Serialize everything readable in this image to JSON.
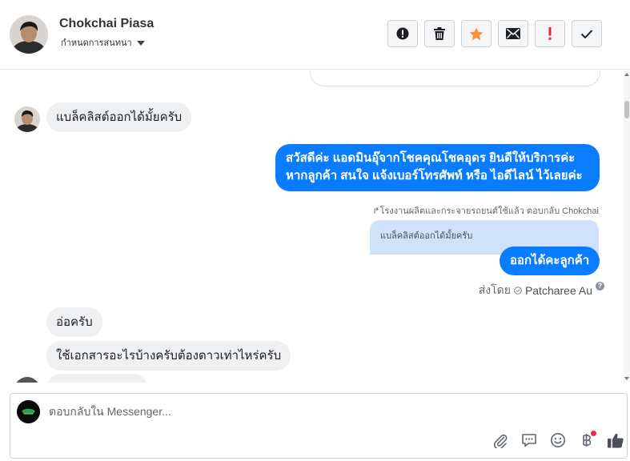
{
  "header": {
    "contact_name": "Chokchai Piasa",
    "stage_label": "กำหนดการสนทนา",
    "actions": [
      {
        "id": "spam",
        "icon": "alert-circle-icon"
      },
      {
        "id": "delete",
        "icon": "trash-icon"
      },
      {
        "id": "star",
        "icon": "star-icon",
        "color": "#f7923b"
      },
      {
        "id": "unread",
        "icon": "envelope-icon"
      },
      {
        "id": "important",
        "icon": "exclamation-icon",
        "color": "#e02c2c"
      },
      {
        "id": "done",
        "icon": "checkmark-icon"
      }
    ]
  },
  "conversation": {
    "messages": [
      {
        "from": "customer",
        "text": "แบล็คลิสต์ออกได้มั้ยครับ"
      },
      {
        "from": "page",
        "lines": [
          "สวัสดีค่ะ แอดมินอุ๊จากโชคคุณโชคอุดร ยินดีให้บริการค่ะ",
          "หากลูกค้า สนใจ แจ้งเบอร์โทรศัพท์ หรือ ไอดีไลน์  ไว้เลยค่ะ"
        ]
      },
      {
        "from": "page",
        "reply_meta": "โรงงานผลิตและกระจายรถยนต์ใช้แล้ว ตอบกลับ Chokchai",
        "quoted_text": "แบล็คลิสต์ออกได้มั้ยครับ",
        "text": "ออกได้คะลูกค้า"
      },
      {
        "from": "customer",
        "text": "อ่อครับ"
      },
      {
        "from": "customer",
        "text": "ใช้เอกสารอะไรบ้างครับต้องดาวเท่าไหร่ครับ"
      }
    ],
    "sent_by_label": "ส่งโดย",
    "sent_by_agent": "Patcharee Au",
    "info_icon": "?"
  },
  "composer": {
    "placeholder": "ตอบกลับใน Messenger...",
    "tools": [
      {
        "id": "attach",
        "icon": "paperclip-icon"
      },
      {
        "id": "saved-replies",
        "icon": "chat-bubble-icon"
      },
      {
        "id": "emoji",
        "icon": "smiley-icon"
      },
      {
        "id": "payment",
        "icon": "baht-icon",
        "badge": true
      },
      {
        "id": "like",
        "icon": "thumbs-up-icon"
      }
    ]
  },
  "colors": {
    "accent": "#0a7cff",
    "incoming": "#eff0f2",
    "quoted": "#cfe2fa"
  }
}
